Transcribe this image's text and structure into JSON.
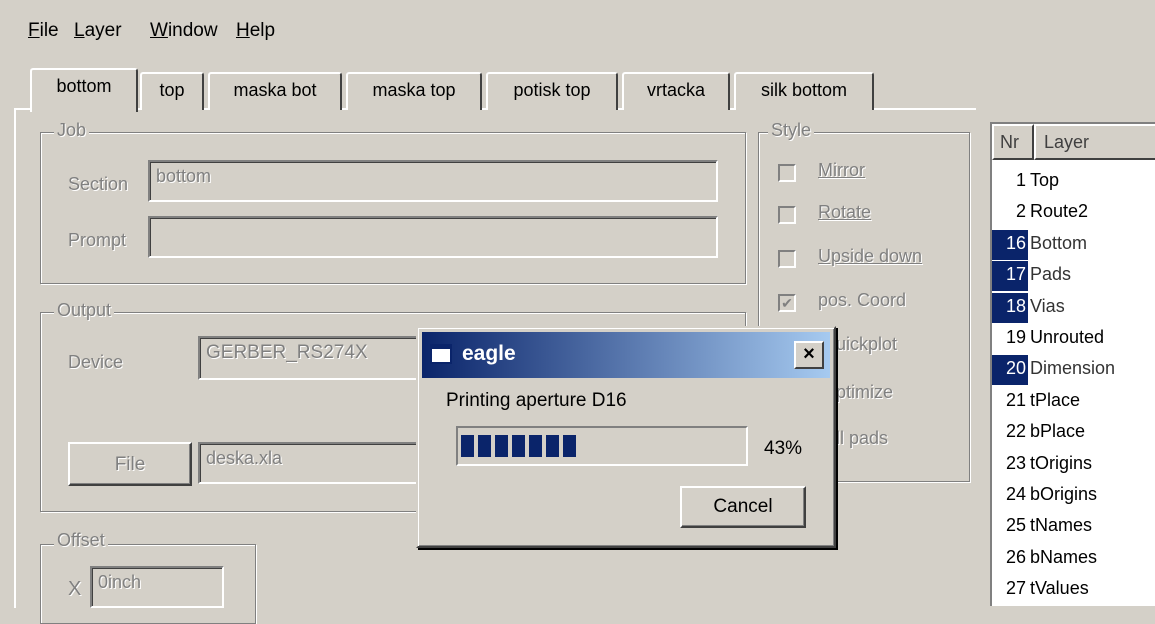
{
  "menu": [
    "File",
    "Layer",
    "Window",
    "Help"
  ],
  "tabs": [
    "bottom",
    "top",
    "maska bot",
    "maska top",
    "potisk top",
    "vrtacka",
    "silk bottom"
  ],
  "job": {
    "title": "Job",
    "section_label": "Section",
    "section_value": "bottom",
    "prompt_label": "Prompt",
    "prompt_value": ""
  },
  "output": {
    "title": "Output",
    "device_label": "Device",
    "device_value": "GERBER_RS274X",
    "file_button": "File",
    "file_value": "deska.xla"
  },
  "offset": {
    "title": "Offset",
    "x_label": "X",
    "x_value": "0inch"
  },
  "style": {
    "title": "Style",
    "options": [
      {
        "label": "Mirror",
        "checked": false
      },
      {
        "label": "Rotate",
        "checked": false
      },
      {
        "label": "Upside down",
        "checked": false
      },
      {
        "label": "pos. Coord",
        "checked": true
      },
      {
        "label": "uickplot",
        "checked": false
      },
      {
        "label": "ptimize",
        "checked": false
      },
      {
        "label": "ll pads",
        "checked": false
      }
    ]
  },
  "layers": {
    "col_nr": "Nr",
    "col_layer": "Layer",
    "rows": [
      {
        "nr": "1",
        "name": "Top",
        "selected": false
      },
      {
        "nr": "2",
        "name": "Route2",
        "selected": false
      },
      {
        "nr": "16",
        "name": "Bottom",
        "selected": true
      },
      {
        "nr": "17",
        "name": "Pads",
        "selected": true
      },
      {
        "nr": "18",
        "name": "Vias",
        "selected": true
      },
      {
        "nr": "19",
        "name": "Unrouted",
        "selected": false
      },
      {
        "nr": "20",
        "name": "Dimension",
        "selected": true
      },
      {
        "nr": "21",
        "name": "tPlace",
        "selected": false
      },
      {
        "nr": "22",
        "name": "bPlace",
        "selected": false
      },
      {
        "nr": "23",
        "name": "tOrigins",
        "selected": false
      },
      {
        "nr": "24",
        "name": "bOrigins",
        "selected": false
      },
      {
        "nr": "25",
        "name": "tNames",
        "selected": false
      },
      {
        "nr": "26",
        "name": "bNames",
        "selected": false
      },
      {
        "nr": "27",
        "name": "tValues",
        "selected": false
      }
    ]
  },
  "dialog": {
    "title": "eagle",
    "message": "Printing aperture D16",
    "progress_percent": 43,
    "progress_text": "43%",
    "cancel_button": "Cancel",
    "close_glyph": "×"
  },
  "colors": {
    "window_bg": "#d4d0c8",
    "selection": "#0a246a",
    "titlebar_start": "#0a246a",
    "titlebar_end": "#a6caf0"
  }
}
